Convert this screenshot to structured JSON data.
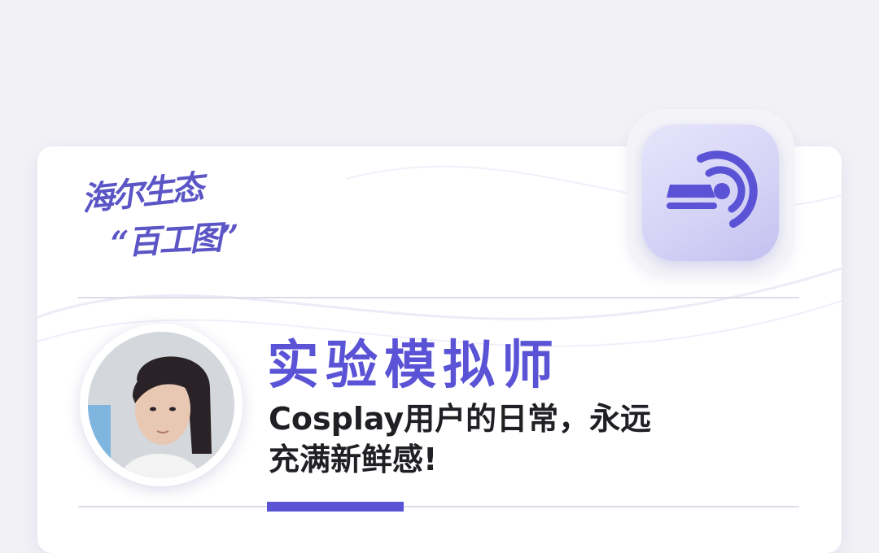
{
  "logo": {
    "line1": "海尔生态",
    "line2": "“百工图”"
  },
  "icon": {
    "name": "mri-scanner-icon"
  },
  "profile": {
    "role_title": "实验模拟师",
    "subtitle_line1": "Cosplay用户的日常，永远",
    "subtitle_line2": "充满新鲜感!"
  },
  "colors": {
    "accent": "#5b53d6",
    "page_background": "#f2f2f6",
    "card_background": "#ffffff",
    "text_dark": "#1f1f24"
  }
}
